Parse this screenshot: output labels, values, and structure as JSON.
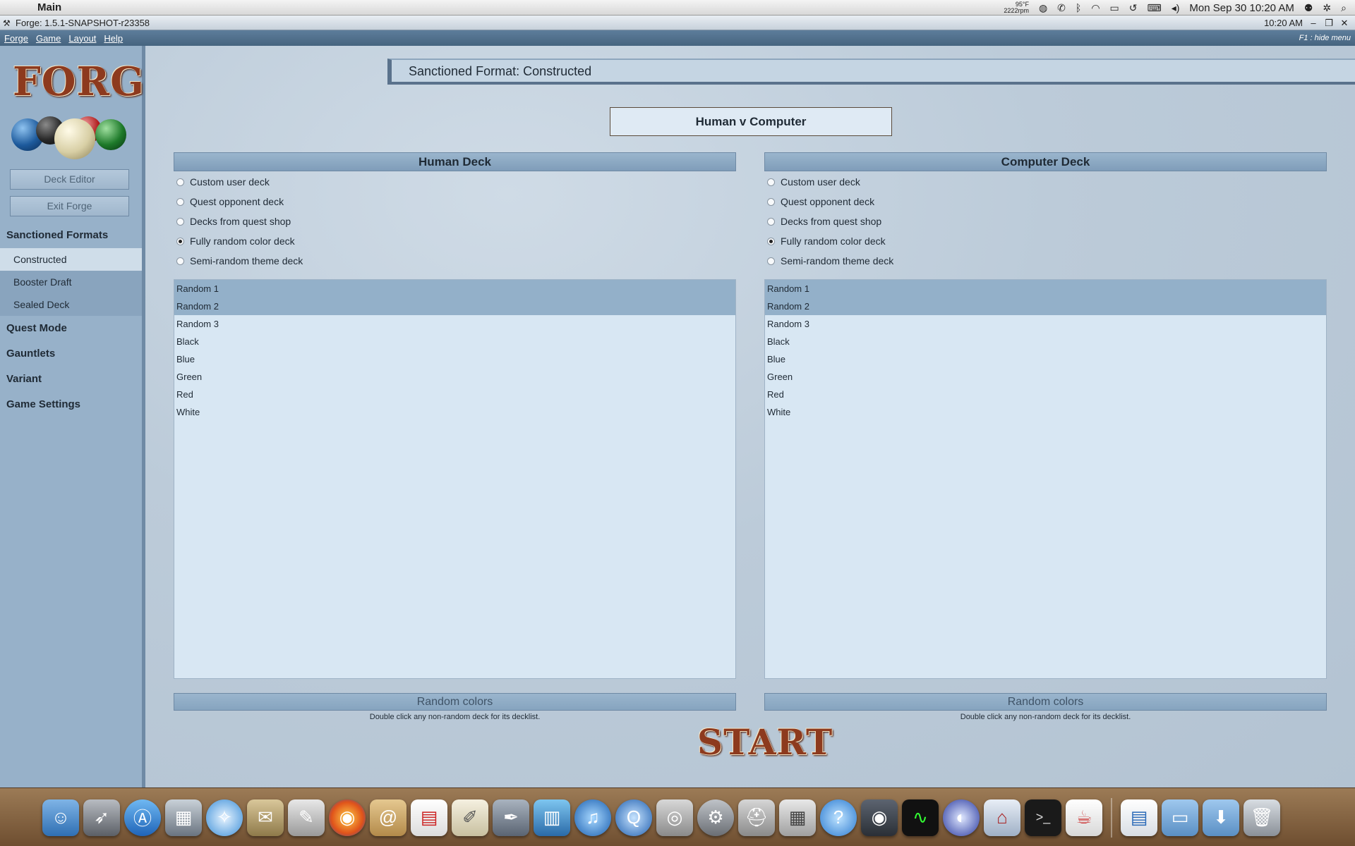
{
  "macbar": {
    "app_name": "Main",
    "temp": "95°F",
    "rpm": "2222rpm",
    "datetime": "Mon Sep 30  10:20 AM"
  },
  "window": {
    "title": "Forge: 1.5.1-SNAPSHOT-r23358",
    "clock": "10:20 AM"
  },
  "appmenu": {
    "items": [
      "Forge",
      "Game",
      "Layout",
      "Help"
    ],
    "hint": "F1 : hide menu"
  },
  "sidebar": {
    "logo_text": "FORGE",
    "buttons": [
      "Deck Editor",
      "Exit Forge"
    ],
    "sections": {
      "sanctioned": "Sanctioned Formats",
      "sanctioned_items": [
        "Constructed",
        "Booster Draft",
        "Sealed Deck"
      ],
      "quest": "Quest Mode",
      "gauntlets": "Gauntlets",
      "variant": "Variant",
      "settings": "Game Settings"
    }
  },
  "main": {
    "header": "Sanctioned Format: Constructed",
    "mode": "Human v Computer",
    "start": "START",
    "panels": [
      {
        "title": "Human Deck",
        "options": [
          "Custom user deck",
          "Quest opponent deck",
          "Decks from quest shop",
          "Fully random color deck",
          "Semi-random theme deck"
        ],
        "selected_option": "Fully random color deck",
        "decks": [
          "Random 1",
          "Random 2",
          "Random 3",
          "Black",
          "Blue",
          "Green",
          "Red",
          "White"
        ],
        "selected_decks": [
          "Random 1",
          "Random 2"
        ],
        "button": "Random colors",
        "hint": "Double click any non-random deck for its decklist."
      },
      {
        "title": "Computer Deck",
        "options": [
          "Custom user deck",
          "Quest opponent deck",
          "Decks from quest shop",
          "Fully random color deck",
          "Semi-random theme deck"
        ],
        "selected_option": "Fully random color deck",
        "decks": [
          "Random 1",
          "Random 2",
          "Random 3",
          "Black",
          "Blue",
          "Green",
          "Red",
          "White"
        ],
        "selected_decks": [
          "Random 1",
          "Random 2"
        ],
        "button": "Random colors",
        "hint": "Double click any non-random deck for its decklist."
      }
    ]
  },
  "colors": {
    "accent": "#5a728c",
    "logo": "#8d3a1e",
    "selection": "#93b0c9"
  }
}
